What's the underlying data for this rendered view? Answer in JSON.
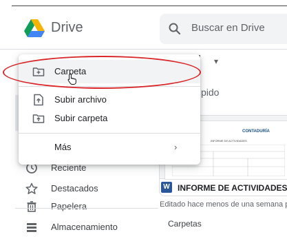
{
  "header": {
    "brand": "Drive",
    "search_placeholder": "Buscar en Drive"
  },
  "main": {
    "title_partial": "d",
    "quick_access_partial": "pido",
    "card": {
      "file_icon_letter": "W",
      "file_name": "INFORME DE ACTIVIDADES di...",
      "thumbnail_logo_text": "CONTADURÍA",
      "thumbnail_doc_title": "INFORME DE ACTIVIDADES"
    },
    "edited_text": "Editado hace menos de una semana p",
    "folders_label": "Carpetas"
  },
  "menu": {
    "items": [
      {
        "label": "Carpeta",
        "icon": "new-folder-icon"
      },
      {
        "label": "Subir archivo",
        "icon": "file-upload-icon"
      },
      {
        "label": "Subir carpeta",
        "icon": "folder-upload-icon"
      },
      {
        "label": "Más",
        "icon": ""
      }
    ]
  },
  "sidebar": {
    "items": [
      {
        "label": "Reciente",
        "icon": "clock-icon"
      },
      {
        "label": "Destacados",
        "icon": "star-icon"
      },
      {
        "label": "Papelera",
        "icon": "trash-icon"
      },
      {
        "label": "Almacenamiento",
        "icon": "storage-icon"
      }
    ]
  },
  "colors": {
    "annotation_red": "#d9262a",
    "word_blue": "#2b579a",
    "drive_green": "#0f9d58",
    "drive_yellow": "#f4b400",
    "drive_blue": "#4285f4"
  }
}
